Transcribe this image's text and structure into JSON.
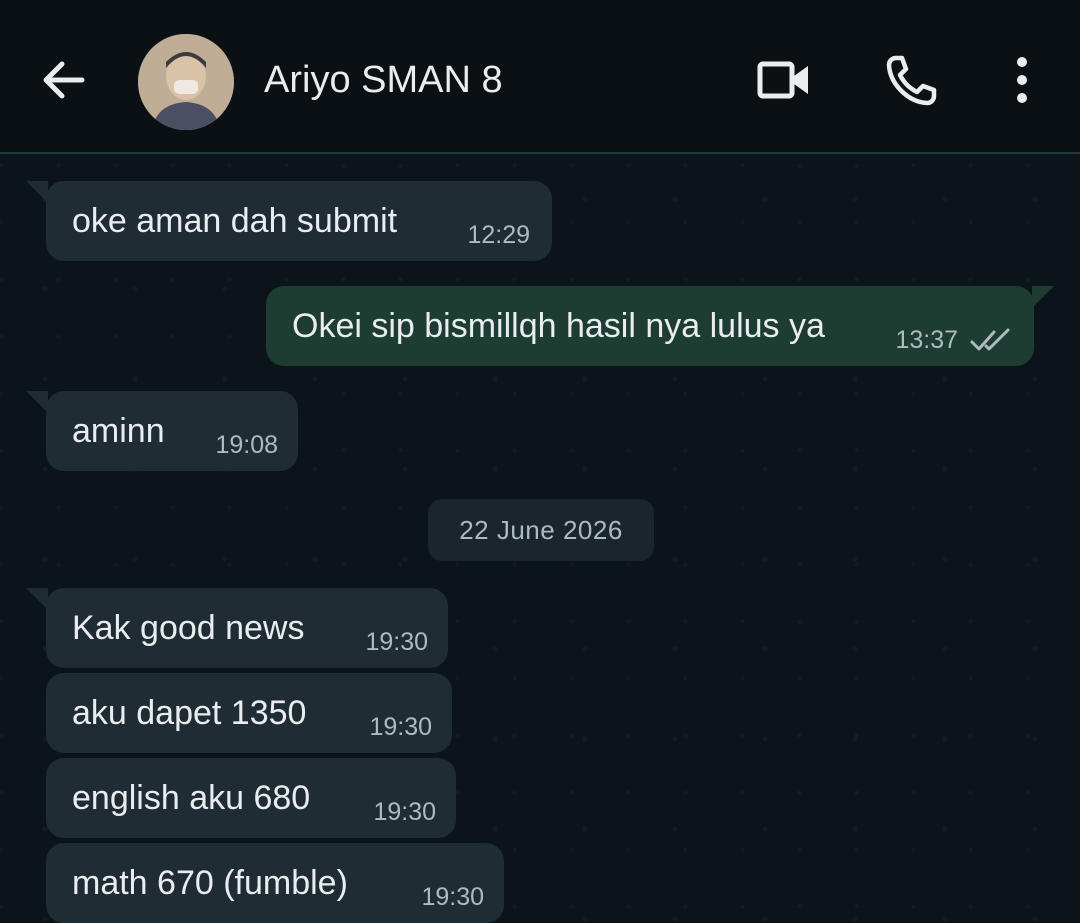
{
  "header": {
    "contact_name": "Ariyo SMAN 8",
    "icons": [
      "back-arrow-icon",
      "video-call-icon",
      "voice-call-icon",
      "more-options-icon"
    ]
  },
  "messages": [
    {
      "direction": "incoming",
      "text": "oke aman dah submit",
      "time": "12:29"
    },
    {
      "direction": "outgoing",
      "text": "Okei sip bismillqh hasil nya lulus ya",
      "time": "13:37",
      "status": "read"
    },
    {
      "direction": "incoming",
      "text": "aminn",
      "time": "19:08"
    },
    {
      "direction": "incoming",
      "text": "Kak good news",
      "time": "19:30"
    },
    {
      "direction": "incoming",
      "text": "aku dapet 1350",
      "time": "19:30"
    },
    {
      "direction": "incoming",
      "text": "english aku 680",
      "time": "19:30"
    },
    {
      "direction": "incoming",
      "text": "math 670 (fumble)",
      "time": "19:30"
    }
  ],
  "date_separator": "22 June 2026",
  "colors": {
    "header_bg": "#0b1014",
    "chat_bg": "#0b141a",
    "incoming_bubble": "#202c33",
    "outgoing_bubble": "#1e3d32",
    "read_tick": "#aebac1"
  }
}
